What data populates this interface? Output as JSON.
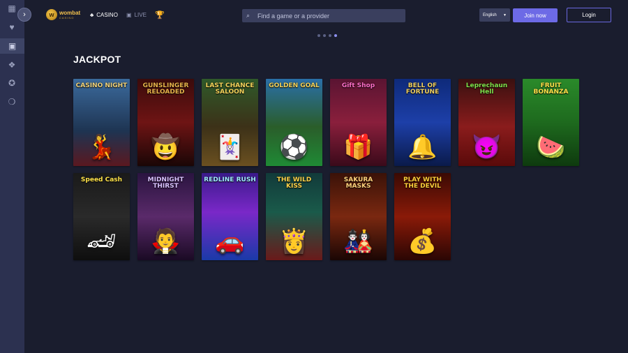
{
  "sidebar": {
    "items": [
      {
        "icon": "grid-icon",
        "glyph": "▦"
      },
      {
        "icon": "heart-icon",
        "glyph": "♥"
      },
      {
        "icon": "slot-machine-icon",
        "glyph": "▣"
      },
      {
        "icon": "gift-icon",
        "glyph": "❖"
      },
      {
        "icon": "poker-chip-icon",
        "glyph": "✪"
      },
      {
        "icon": "chat-icon",
        "glyph": "❍"
      }
    ],
    "expand_glyph": "›"
  },
  "header": {
    "logo_name": "wombat",
    "logo_sub": "CASINO",
    "logo_glyph": "w",
    "nav": {
      "casino_icon": "♣",
      "casino_label": "CASINO",
      "live_icon": "▣",
      "live_label": "LIVE",
      "trophy_icon": "🏆"
    },
    "search": {
      "placeholder": "Find a game or a provider",
      "value": "",
      "icon": "⌕"
    },
    "language": {
      "value": "English",
      "caret": "▼"
    },
    "join_label": "Join now",
    "login_label": "Login"
  },
  "carousel": {
    "dot_count": 4,
    "active_index": 3
  },
  "section": {
    "title": "JACKPOT",
    "games": [
      {
        "title": "CASINO NIGHT",
        "color": "#f0d27a",
        "art": "💃",
        "bg": "linear-gradient(180deg,#3b6a9c 0%,#1e3452 60%,#5a1820 100%)"
      },
      {
        "title": "GUNSLINGER RELOADED",
        "color": "#e6b34a",
        "art": "🤠",
        "bg": "linear-gradient(180deg,#3a0b0b 0%,#6e1414 50%,#1a0606 100%)"
      },
      {
        "title": "LAST CHANCE SALOON",
        "color": "#f4d25a",
        "art": "🃏",
        "bg": "linear-gradient(180deg,#2f5a2a 0%,#3c3118 55%,#6b5020 100%)"
      },
      {
        "title": "GOLDEN GOAL",
        "color": "#f4d25a",
        "art": "⚽",
        "bg": "linear-gradient(180deg,#2a6fa8 0%,#2a5d2a 55%,#1f8a35 100%)"
      },
      {
        "title": "Gift Shop",
        "color": "#ff6fc8",
        "art": "🎁",
        "bg": "linear-gradient(180deg,#5a1432 0%,#8a1f3c 50%,#3a0a1a 100%)"
      },
      {
        "title": "BELL OF FORTUNE",
        "color": "#f0d060",
        "art": "🔔",
        "bg": "linear-gradient(180deg,#0e2a7a 0%,#1d3fa8 50%,#0a1a4a 100%)"
      },
      {
        "title": "Leprechaun Hell",
        "color": "#7fe04a",
        "art": "😈",
        "bg": "linear-gradient(180deg,#3a1010 0%,#8a1c1c 55%,#5a0a0a 100%)"
      },
      {
        "title": "FRUIT BONANZA",
        "color": "#ffe34a",
        "art": "🍉",
        "bg": "linear-gradient(180deg,#2a8a2a 0%,#1e6a1e 50%,#0e3a0e 100%)"
      },
      {
        "title": "Speed Cash",
        "color": "#ffe34a",
        "art": "🏎",
        "bg": "linear-gradient(180deg,#1a1a1a 0%,#2a2a2a 50%,#0e0e0e 100%)"
      },
      {
        "title": "MIDNIGHT THIRST",
        "color": "#d9c2ff",
        "art": "🧛",
        "bg": "linear-gradient(180deg,#2a1440 0%,#5a2a6a 50%,#1a0a24 100%)"
      },
      {
        "title": "REDLINE RUSH",
        "color": "#9fe8ff",
        "art": "🚗",
        "bg": "linear-gradient(180deg,#3a1a8a 0%,#7a28c8 45%,#1a3aa8 100%)"
      },
      {
        "title": "THE WILD KISS",
        "color": "#ffd34a",
        "art": "👸",
        "bg": "linear-gradient(180deg,#123a3a 0%,#1a5a4a 45%,#6a1a1a 100%)"
      },
      {
        "title": "SAKURA MASKS",
        "color": "#ffd07a",
        "art": "🎎",
        "bg": "linear-gradient(180deg,#3a1208 0%,#7a2810 50%,#1a0604 100%)"
      },
      {
        "title": "PLAY WITH THE DEVIL",
        "color": "#ffcf3a",
        "art": "💰",
        "bg": "linear-gradient(180deg,#3a0a04 0%,#8a1a08 50%,#2a0604 100%)"
      }
    ]
  }
}
